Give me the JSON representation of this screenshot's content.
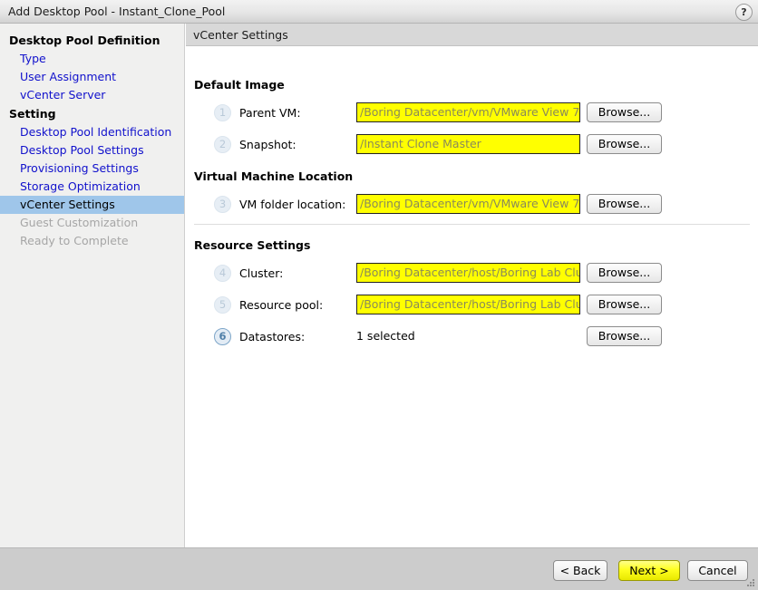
{
  "window": {
    "title": "Add Desktop Pool - Instant_Clone_Pool",
    "help_icon": "question-mark-icon"
  },
  "sidebar": {
    "groups": [
      {
        "label": "Desktop Pool Definition",
        "items": [
          {
            "label": "Type",
            "state": "link"
          },
          {
            "label": "User Assignment",
            "state": "link"
          },
          {
            "label": "vCenter Server",
            "state": "link"
          }
        ]
      },
      {
        "label": "Setting",
        "items": [
          {
            "label": "Desktop Pool Identification",
            "state": "link"
          },
          {
            "label": "Desktop Pool Settings",
            "state": "link"
          },
          {
            "label": "Provisioning Settings",
            "state": "link"
          },
          {
            "label": "Storage Optimization",
            "state": "link"
          },
          {
            "label": "vCenter Settings",
            "state": "selected"
          },
          {
            "label": "Guest Customization",
            "state": "disabled"
          },
          {
            "label": "Ready to Complete",
            "state": "disabled"
          }
        ]
      }
    ]
  },
  "content": {
    "header": "vCenter Settings",
    "sections": [
      {
        "title": "Default Image"
      },
      {
        "title": "Virtual Machine Location"
      },
      {
        "title": "Resource Settings"
      }
    ],
    "rows": [
      {
        "step": "1",
        "label": "Parent VM:",
        "value": "/Boring Datacenter/vm/VMware View 7",
        "button": "Browse...",
        "badge_state": "inactive"
      },
      {
        "step": "2",
        "label": "Snapshot:",
        "value": "/Instant Clone Master",
        "button": "Browse...",
        "badge_state": "inactive"
      },
      {
        "step": "3",
        "label": "VM folder location:",
        "value": "/Boring Datacenter/vm/VMware View 7",
        "button": "Browse...",
        "badge_state": "inactive"
      },
      {
        "step": "4",
        "label": "Cluster:",
        "value": "/Boring Datacenter/host/Boring Lab Cluster",
        "button": "Browse...",
        "badge_state": "inactive"
      },
      {
        "step": "5",
        "label": "Resource pool:",
        "value": "/Boring Datacenter/host/Boring Lab Cluster",
        "button": "Browse...",
        "badge_state": "inactive"
      },
      {
        "step": "6",
        "label": "Datastores:",
        "value": "1 selected",
        "button": "Browse...",
        "badge_state": "active"
      }
    ]
  },
  "footer": {
    "back": "< Back",
    "next": "Next >",
    "cancel": "Cancel"
  },
  "colors": {
    "field_highlight": "#ffff00",
    "selected_nav": "#9fc6ea",
    "link": "#1111cc",
    "primary_button": "#ffff20",
    "footer_bg": "#cccccc"
  }
}
